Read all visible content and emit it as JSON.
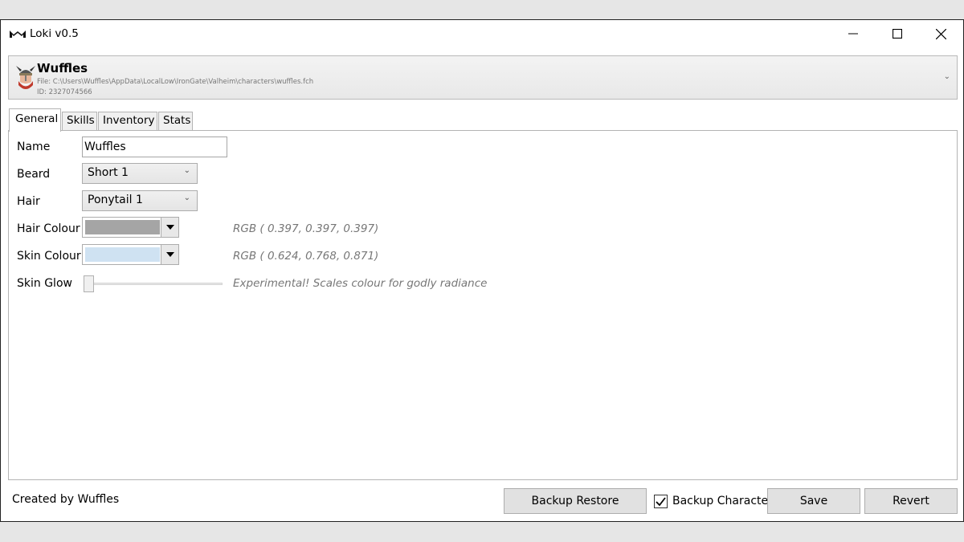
{
  "window": {
    "title": "Loki v0.5",
    "icon": "loki-logo-icon",
    "controls": {
      "minimize": "minimize-icon",
      "maximize": "maximize-icon",
      "close": "close-icon"
    }
  },
  "character": {
    "name": "Wuffles",
    "file": "File: C:\\Users\\Wuffles\\AppData\\LocalLow\\IronGate\\Valheim\\characters\\wuffles.fch",
    "id": "ID: 2327074566",
    "avatar": "viking-avatar-icon"
  },
  "tabs": [
    {
      "label": "General",
      "active": true
    },
    {
      "label": "Skills",
      "active": false
    },
    {
      "label": "Inventory",
      "active": false
    },
    {
      "label": "Stats",
      "active": false
    }
  ],
  "general": {
    "name_label": "Name",
    "name_value": "Wuffles",
    "beard_label": "Beard",
    "beard_value": "Short 1",
    "hair_label": "Hair",
    "hair_value": "Ponytail 1",
    "hair_colour_label": "Hair Colour",
    "hair_colour_hex": "#a5a5a5",
    "hair_colour_rgb": "RGB ( 0.397, 0.397, 0.397)",
    "skin_colour_label": "Skin Colour",
    "skin_colour_hex": "#cfe2f2",
    "skin_colour_rgb": "RGB ( 0.624, 0.768, 0.871)",
    "skin_glow_label": "Skin Glow",
    "skin_glow_value": 0,
    "skin_glow_note": "Experimental! Scales colour for godly radiance"
  },
  "footer": {
    "created_by": "Created by Wuffles",
    "backup_restore": "Backup Restore",
    "backup_character_label": "Backup Character",
    "backup_character_checked": true,
    "save": "Save",
    "revert": "Revert"
  }
}
